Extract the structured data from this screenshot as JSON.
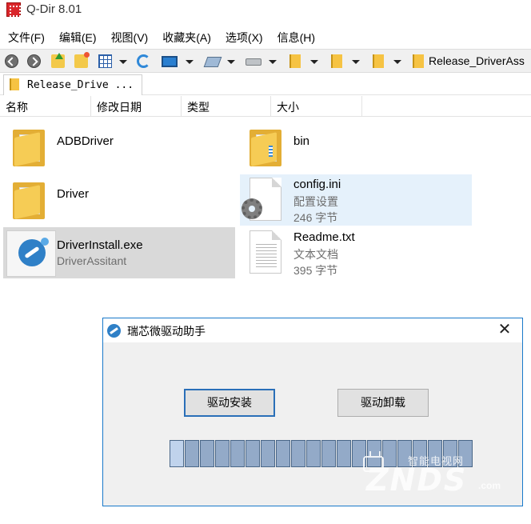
{
  "window": {
    "title": "Q-Dir 8.01"
  },
  "menu": [
    "文件(F)",
    "编辑(E)",
    "视图(V)",
    "收藏夹(A)",
    "选项(X)",
    "信息(H)"
  ],
  "toolbar": {
    "path": "Release_DriverAss"
  },
  "tab": {
    "label": "Release_Drive ..."
  },
  "columns": [
    "名称",
    "修改日期",
    "类型",
    "大小"
  ],
  "files": [
    {
      "name": "ADBDriver",
      "kind": "folder"
    },
    {
      "name": "bin",
      "kind": "folder"
    },
    {
      "name": "Driver",
      "kind": "folder"
    },
    {
      "name": "config.ini",
      "type": "配置设置",
      "size": "246 字节",
      "kind": "ini"
    },
    {
      "name": "DriverInstall.exe",
      "type": "DriverAssitant",
      "kind": "exe"
    },
    {
      "name": "Readme.txt",
      "type": "文本文档",
      "size": "395 字节",
      "kind": "txt"
    }
  ],
  "dialog": {
    "title": "瑞芯微驱动助手",
    "close_glyph": "✕",
    "install_label": "驱动安装",
    "uninstall_label": "驱动卸载",
    "progress_segments": 20
  },
  "watermark": {
    "top": "智能电视网",
    "main": "ZNDS",
    "suffix": ".com"
  }
}
